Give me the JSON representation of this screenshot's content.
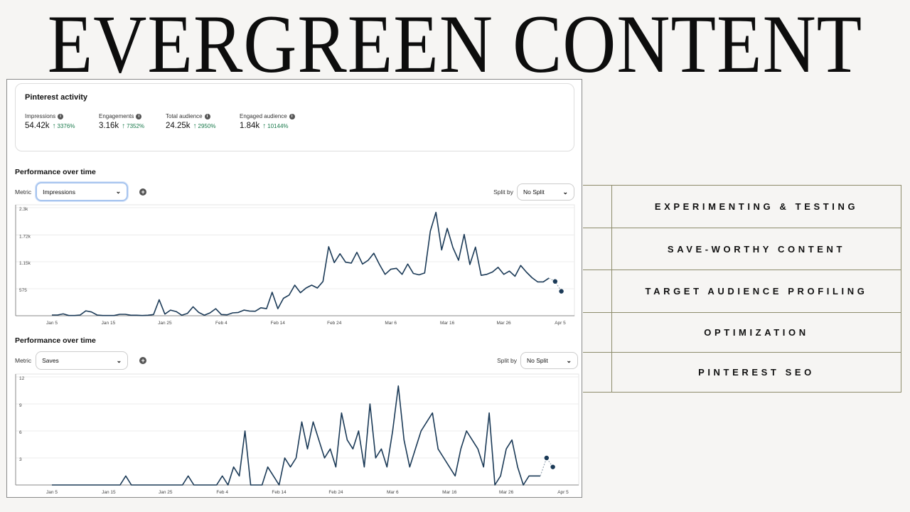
{
  "title": "EVERGREEN CONTENT",
  "activity": {
    "heading": "Pinterest activity",
    "stats": [
      {
        "label": "Impressions",
        "value": "54.42k",
        "change": "3376%",
        "direction": "up"
      },
      {
        "label": "Engagements",
        "value": "3.16k",
        "change": "7352%",
        "direction": "up"
      },
      {
        "label": "Total audience",
        "value": "24.25k",
        "change": "2950%",
        "direction": "up"
      },
      {
        "label": "Engaged audience",
        "value": "1.84k",
        "change": "10144%",
        "direction": "up"
      }
    ]
  },
  "panels": [
    {
      "heading": "Performance over time",
      "metric_label": "Metric",
      "metric_value": "Impressions",
      "split_label": "Split by",
      "split_value": "No Split"
    },
    {
      "heading": "Performance over time",
      "metric_label": "Metric",
      "metric_value": "Saves",
      "split_label": "Split by",
      "split_value": "No Split"
    }
  ],
  "icons": {
    "info": "i",
    "arrow_up": "↑",
    "chevron_down": "⌄",
    "plus": "+"
  },
  "line_color": "#1b3a57",
  "right_list": [
    "EXPERIMENTING & TESTING",
    "SAVE-WORTHY CONTENT",
    "TARGET AUDIENCE PROFILING",
    "OPTIMIZATION",
    "PINTEREST SEO"
  ],
  "chart_data": [
    {
      "type": "line",
      "title": "Impressions",
      "xlabel": "",
      "ylabel": "",
      "x_ticks": [
        "Jan 5",
        "Jan 15",
        "Jan 25",
        "Feb 4",
        "Feb 14",
        "Feb 24",
        "Mar 6",
        "Mar 16",
        "Mar 26",
        "Apr 5"
      ],
      "y_ticks": [
        "575",
        "1.15k",
        "1.72k",
        "2.3k"
      ],
      "y_tick_values": [
        575,
        1150,
        1720,
        2300
      ],
      "ylim": [
        0,
        2300
      ],
      "x_start": "Jan 5",
      "day_step": 1,
      "grid": true,
      "values": [
        15,
        15,
        40,
        5,
        5,
        15,
        105,
        80,
        15,
        5,
        5,
        5,
        30,
        30,
        10,
        10,
        5,
        10,
        25,
        340,
        35,
        120,
        90,
        10,
        50,
        190,
        70,
        10,
        60,
        150,
        25,
        20,
        60,
        70,
        120,
        100,
        95,
        170,
        150,
        500,
        150,
        370,
        440,
        650,
        490,
        590,
        650,
        590,
        730,
        1470,
        1130,
        1320,
        1140,
        1120,
        1350,
        1100,
        1180,
        1330,
        1090,
        880,
        990,
        1010,
        880,
        1100,
        900,
        870,
        910,
        1800,
        2200,
        1400,
        1860,
        1450,
        1180,
        1730,
        1090,
        1460,
        860,
        880,
        930,
        1030,
        880,
        950,
        840,
        1070,
        930,
        810,
        720,
        720,
        800
      ],
      "projected": [
        800,
        730,
        520
      ]
    },
    {
      "type": "line",
      "title": "Saves",
      "xlabel": "",
      "ylabel": "",
      "x_ticks": [
        "Jan 5",
        "Jan 15",
        "Jan 25",
        "Feb 4",
        "Feb 14",
        "Feb 24",
        "Mar 6",
        "Mar 16",
        "Mar 26",
        "Apr 5"
      ],
      "y_ticks": [
        "3",
        "6",
        "9",
        "12"
      ],
      "y_tick_values": [
        3,
        6,
        9,
        12
      ],
      "ylim": [
        0,
        12
      ],
      "x_start": "Jan 5",
      "day_step": 1,
      "grid": true,
      "values": [
        0,
        0,
        0,
        0,
        0,
        0,
        0,
        0,
        0,
        0,
        0,
        0,
        0,
        1,
        0,
        0,
        0,
        0,
        0,
        0,
        0,
        0,
        0,
        0,
        1,
        0,
        0,
        0,
        0,
        0,
        1,
        0,
        2,
        1,
        6,
        0,
        0,
        0,
        2,
        1,
        0,
        3,
        2,
        3,
        7,
        4,
        7,
        5,
        3,
        4,
        2,
        8,
        5,
        4,
        6,
        2,
        9,
        3,
        4,
        2,
        6,
        11,
        5,
        2,
        4,
        6,
        7,
        8,
        4,
        3,
        2,
        1,
        4,
        6,
        5,
        4,
        2,
        8,
        0,
        1,
        4,
        5,
        2,
        0,
        1,
        1,
        1
      ],
      "projected": [
        1,
        3,
        2
      ]
    }
  ]
}
